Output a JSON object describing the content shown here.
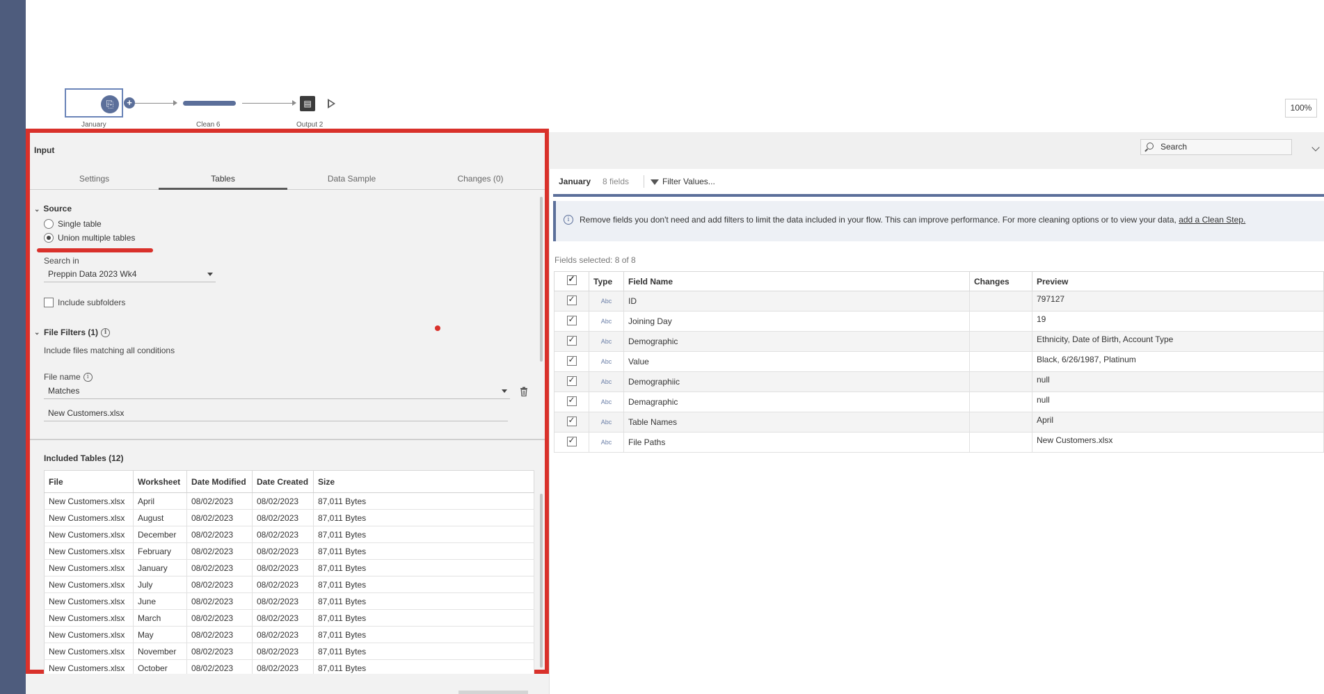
{
  "flow": {
    "nodes": [
      "January",
      "Clean 6",
      "Output 2"
    ],
    "zoom": "100%"
  },
  "input_panel": {
    "title": "Input",
    "tabs": [
      "Settings",
      "Tables",
      "Data Sample",
      "Changes (0)"
    ],
    "active_tab": "Tables",
    "source": {
      "title": "Source",
      "options": [
        "Single table",
        "Union multiple tables"
      ],
      "selected": "Union multiple tables"
    },
    "search_in": {
      "label": "Search in",
      "value": "Preppin Data 2023 Wk4"
    },
    "include_subfolders": {
      "label": "Include subfolders",
      "checked": false
    },
    "file_filters": {
      "title": "File Filters (1)",
      "description": "Include files matching all conditions",
      "file_name_label": "File name",
      "condition": "Matches",
      "pattern": "New Customers.xlsx"
    },
    "included_tables": {
      "title": "Included Tables (12)",
      "columns": [
        "File",
        "Worksheet",
        "Date Modified",
        "Date Created",
        "Size"
      ],
      "rows": [
        [
          "New Customers.xlsx",
          "April",
          "08/02/2023",
          "08/02/2023",
          "87,011 Bytes"
        ],
        [
          "New Customers.xlsx",
          "August",
          "08/02/2023",
          "08/02/2023",
          "87,011 Bytes"
        ],
        [
          "New Customers.xlsx",
          "December",
          "08/02/2023",
          "08/02/2023",
          "87,011 Bytes"
        ],
        [
          "New Customers.xlsx",
          "February",
          "08/02/2023",
          "08/02/2023",
          "87,011 Bytes"
        ],
        [
          "New Customers.xlsx",
          "January",
          "08/02/2023",
          "08/02/2023",
          "87,011 Bytes"
        ],
        [
          "New Customers.xlsx",
          "July",
          "08/02/2023",
          "08/02/2023",
          "87,011 Bytes"
        ],
        [
          "New Customers.xlsx",
          "June",
          "08/02/2023",
          "08/02/2023",
          "87,011 Bytes"
        ],
        [
          "New Customers.xlsx",
          "March",
          "08/02/2023",
          "08/02/2023",
          "87,011 Bytes"
        ],
        [
          "New Customers.xlsx",
          "May",
          "08/02/2023",
          "08/02/2023",
          "87,011 Bytes"
        ],
        [
          "New Customers.xlsx",
          "November",
          "08/02/2023",
          "08/02/2023",
          "87,011 Bytes"
        ],
        [
          "New Customers.xlsx",
          "October",
          "08/02/2023",
          "08/02/2023",
          "87,011 Bytes"
        ]
      ]
    }
  },
  "right_pane": {
    "search_placeholder": "Search",
    "step_name": "January",
    "field_count": "8 fields",
    "filter_label": "Filter Values...",
    "info_text": "Remove fields you don't need and add filters to limit the data included in your flow. This can improve performance. For more cleaning options or to view your data,",
    "info_link": "add a Clean Step.",
    "fields_selected": "Fields selected: 8 of 8",
    "columns": [
      "Type",
      "Field Name",
      "Changes",
      "Preview"
    ],
    "fields": [
      {
        "type": "Abc",
        "name": "ID",
        "changes": "",
        "preview": "797127"
      },
      {
        "type": "Abc",
        "name": "Joining Day",
        "changes": "",
        "preview": "19"
      },
      {
        "type": "Abc",
        "name": "Demographic",
        "changes": "",
        "preview": "Ethnicity, Date of Birth, Account Type"
      },
      {
        "type": "Abc",
        "name": "Value",
        "changes": "",
        "preview": "Black, 6/26/1987, Platinum"
      },
      {
        "type": "Abc",
        "name": "Demographiic",
        "changes": "",
        "preview": "null"
      },
      {
        "type": "Abc",
        "name": "Demagraphic",
        "changes": "",
        "preview": "null"
      },
      {
        "type": "Abc",
        "name": "Table Names",
        "changes": "",
        "preview": "April"
      },
      {
        "type": "Abc",
        "name": "File Paths",
        "changes": "",
        "preview": "New Customers.xlsx"
      }
    ]
  }
}
